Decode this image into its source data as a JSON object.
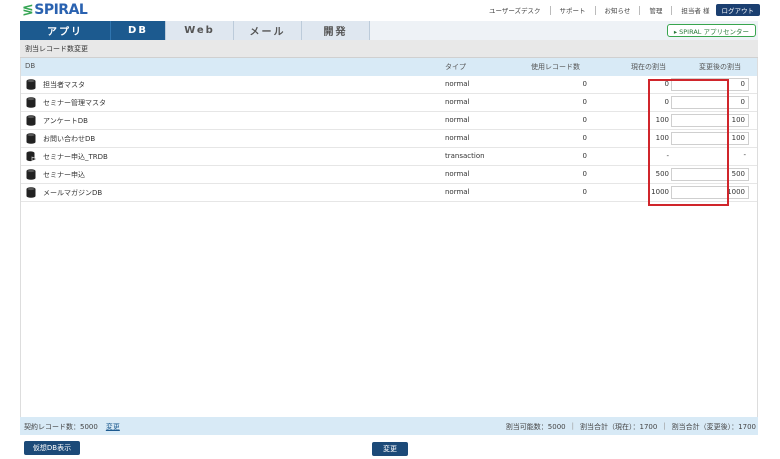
{
  "header": {
    "logo": "SPIRAL",
    "util_links": [
      "ユーザーズデスク",
      "サポート",
      "お知らせ",
      "管理"
    ],
    "user": "担当者 様",
    "logout": "ログアウト"
  },
  "nav": {
    "tabs": [
      "アプリ",
      "DB",
      "Web",
      "メール",
      "開発"
    ],
    "active": "DB",
    "app_center": "▸ SPIRAL アプリセンター"
  },
  "section_title": "割当レコード数変更",
  "table": {
    "headers": {
      "db": "DB",
      "type": "タイプ",
      "used": "使用レコード数",
      "current": "現在の割当",
      "new": "変更後の割当"
    },
    "rows": [
      {
        "name": "担当者マスタ",
        "icon": "database-icon",
        "type": "normal",
        "used": "0",
        "current": "0",
        "new": "0"
      },
      {
        "name": "セミナー管理マスタ",
        "icon": "database-icon",
        "type": "normal",
        "used": "0",
        "current": "0",
        "new": "0"
      },
      {
        "name": "アンケートDB",
        "icon": "database-icon",
        "type": "normal",
        "used": "0",
        "current": "100",
        "new": "100"
      },
      {
        "name": "お問い合わせDB",
        "icon": "database-icon",
        "type": "normal",
        "used": "0",
        "current": "100",
        "new": "100"
      },
      {
        "name": "セミナー申込_TRDB",
        "icon": "transaction-database-icon",
        "type": "transaction",
        "used": "0",
        "current": "-",
        "new": "-"
      },
      {
        "name": "セミナー申込",
        "icon": "database-icon",
        "type": "normal",
        "used": "0",
        "current": "500",
        "new": "500"
      },
      {
        "name": "メールマガジンDB",
        "icon": "database-icon",
        "type": "normal",
        "used": "0",
        "current": "1000",
        "new": "1000"
      }
    ]
  },
  "footer": {
    "contract": "契約レコード数：5000",
    "change_link": "変更",
    "assignable": "割当可能数：5000",
    "total_current": "割当合計（現在）：1700",
    "total_new": "割当合計（変更後）：1700"
  },
  "buttons": {
    "virtual_db": "仮想DB表示",
    "change": "変更"
  },
  "colors": {
    "brand_blue": "#1c5a8f",
    "highlight_red": "#d0252b",
    "header_bg": "#d8eaf6"
  }
}
